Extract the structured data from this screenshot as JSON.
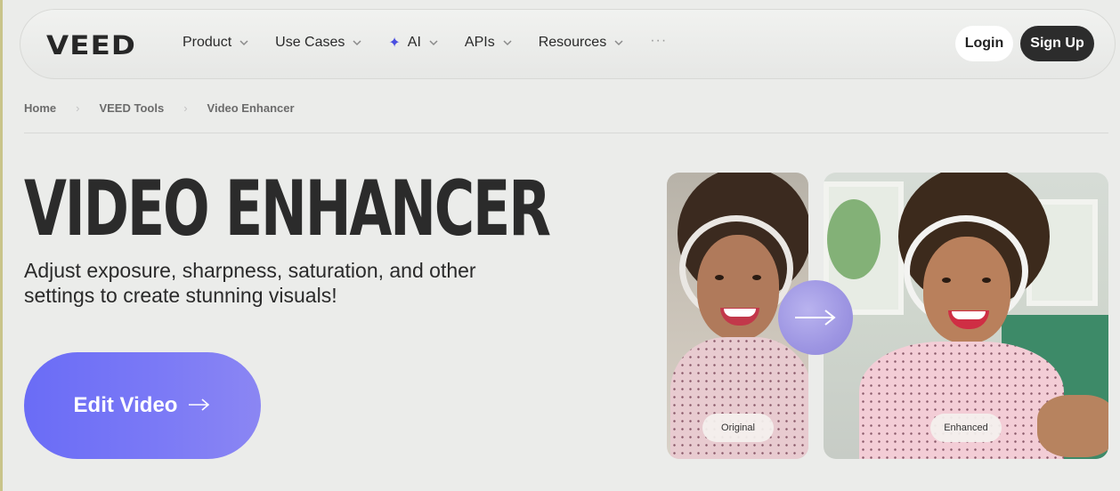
{
  "nav": {
    "logo": "VEED",
    "items": [
      {
        "label": "Product",
        "has_dropdown": true
      },
      {
        "label": "Use Cases",
        "has_dropdown": true
      },
      {
        "label": "AI",
        "has_dropdown": true,
        "icon": "sparkle-icon"
      },
      {
        "label": "APIs",
        "has_dropdown": true
      },
      {
        "label": "Resources",
        "has_dropdown": true
      }
    ],
    "more": "···",
    "login_label": "Login",
    "signup_label": "Sign Up"
  },
  "breadcrumb": [
    "Home",
    "VEED Tools",
    "Video Enhancer"
  ],
  "hero": {
    "title": "VIDEO ENHANCER",
    "subtitle": "Adjust exposure, sharpness, saturation, and other settings to create stunning visuals!",
    "cta_label": "Edit Video"
  },
  "comparison": {
    "before_label": "Original",
    "after_label": "Enhanced"
  },
  "colors": {
    "background": "#ebecea",
    "cta_start": "#6a6cf6",
    "cta_end": "#8b86f3",
    "signup_bg": "#2c2c2c",
    "ai_spark": "#4b4fe0"
  }
}
